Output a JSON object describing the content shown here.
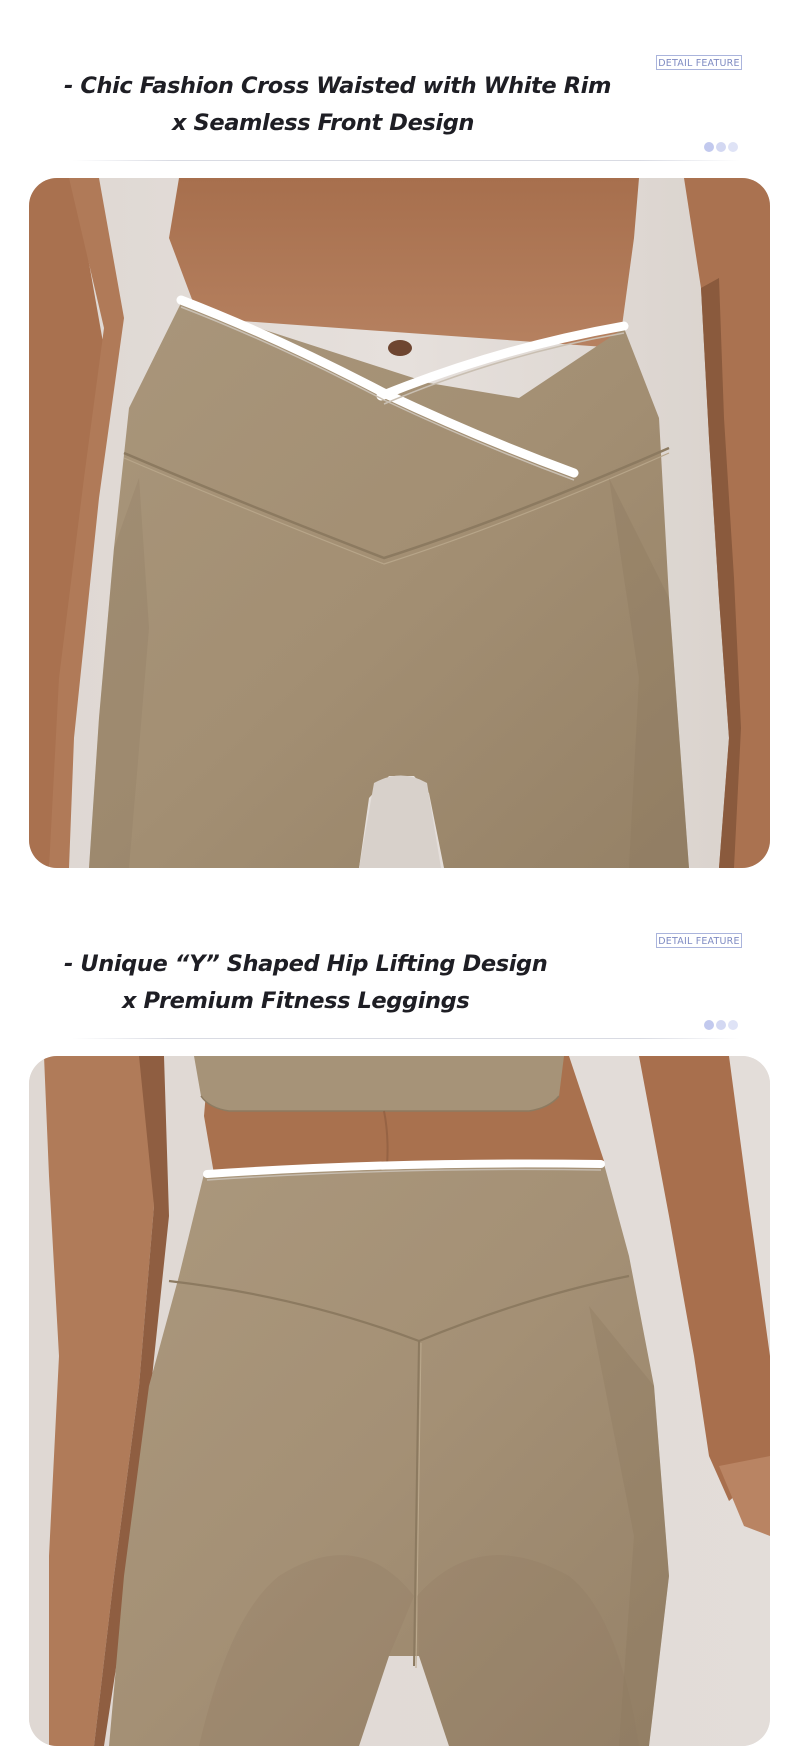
{
  "sections": [
    {
      "badge": "DETAIL FEATURE",
      "title_line1": "- Chic Fashion Cross Waisted with White Rim",
      "title_line2": "x Seamless Front Design",
      "photo_icon": "leggings-front-photo"
    },
    {
      "badge": "DETAIL FEATURE",
      "title_line1": "- Unique “Y” Shaped Hip Lifting Design",
      "title_line2": "x Premium Fitness Leggings",
      "photo_icon": "leggings-back-photo"
    }
  ],
  "colors": {
    "badge_border": "#aab4dc",
    "badge_text": "#7f8bc2",
    "dot_1": "#c2c9ee",
    "dot_2": "#d3d8f2",
    "dot_3": "#dfe3f6",
    "legging": "#a79478",
    "skin": "#b07a58",
    "background": "#e3ddd8",
    "waistband_rim": "#ffffff"
  }
}
